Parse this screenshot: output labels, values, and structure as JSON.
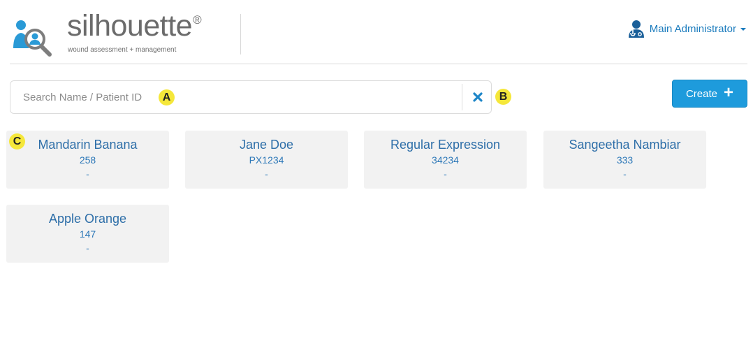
{
  "brand": {
    "name": "silhouette",
    "registered": "®",
    "tagline": "wound assessment + management"
  },
  "user": {
    "label": "Main Administrator",
    "icon": "doctor-user-icon"
  },
  "search": {
    "placeholder": "Search Name / Patient ID",
    "value": "",
    "clear_icon": "close-icon"
  },
  "create": {
    "label": "Create",
    "icon": "plus-icon"
  },
  "markers": {
    "a": "A",
    "b": "B",
    "c": "C"
  },
  "patients": [
    {
      "name": "Mandarin Banana",
      "id": "258",
      "extra": "-"
    },
    {
      "name": "Jane Doe",
      "id": "PX1234",
      "extra": "-"
    },
    {
      "name": "Regular Expression",
      "id": "34234",
      "extra": "-"
    },
    {
      "name": "Sangeetha Nambiar",
      "id": "333",
      "extra": "-"
    },
    {
      "name": "Apple Orange",
      "id": "147",
      "extra": "-"
    }
  ],
  "colors": {
    "accent": "#1e9bdc",
    "link": "#2d6ea8",
    "card_bg": "#f2f2f2",
    "marker": "#f5e73a"
  }
}
